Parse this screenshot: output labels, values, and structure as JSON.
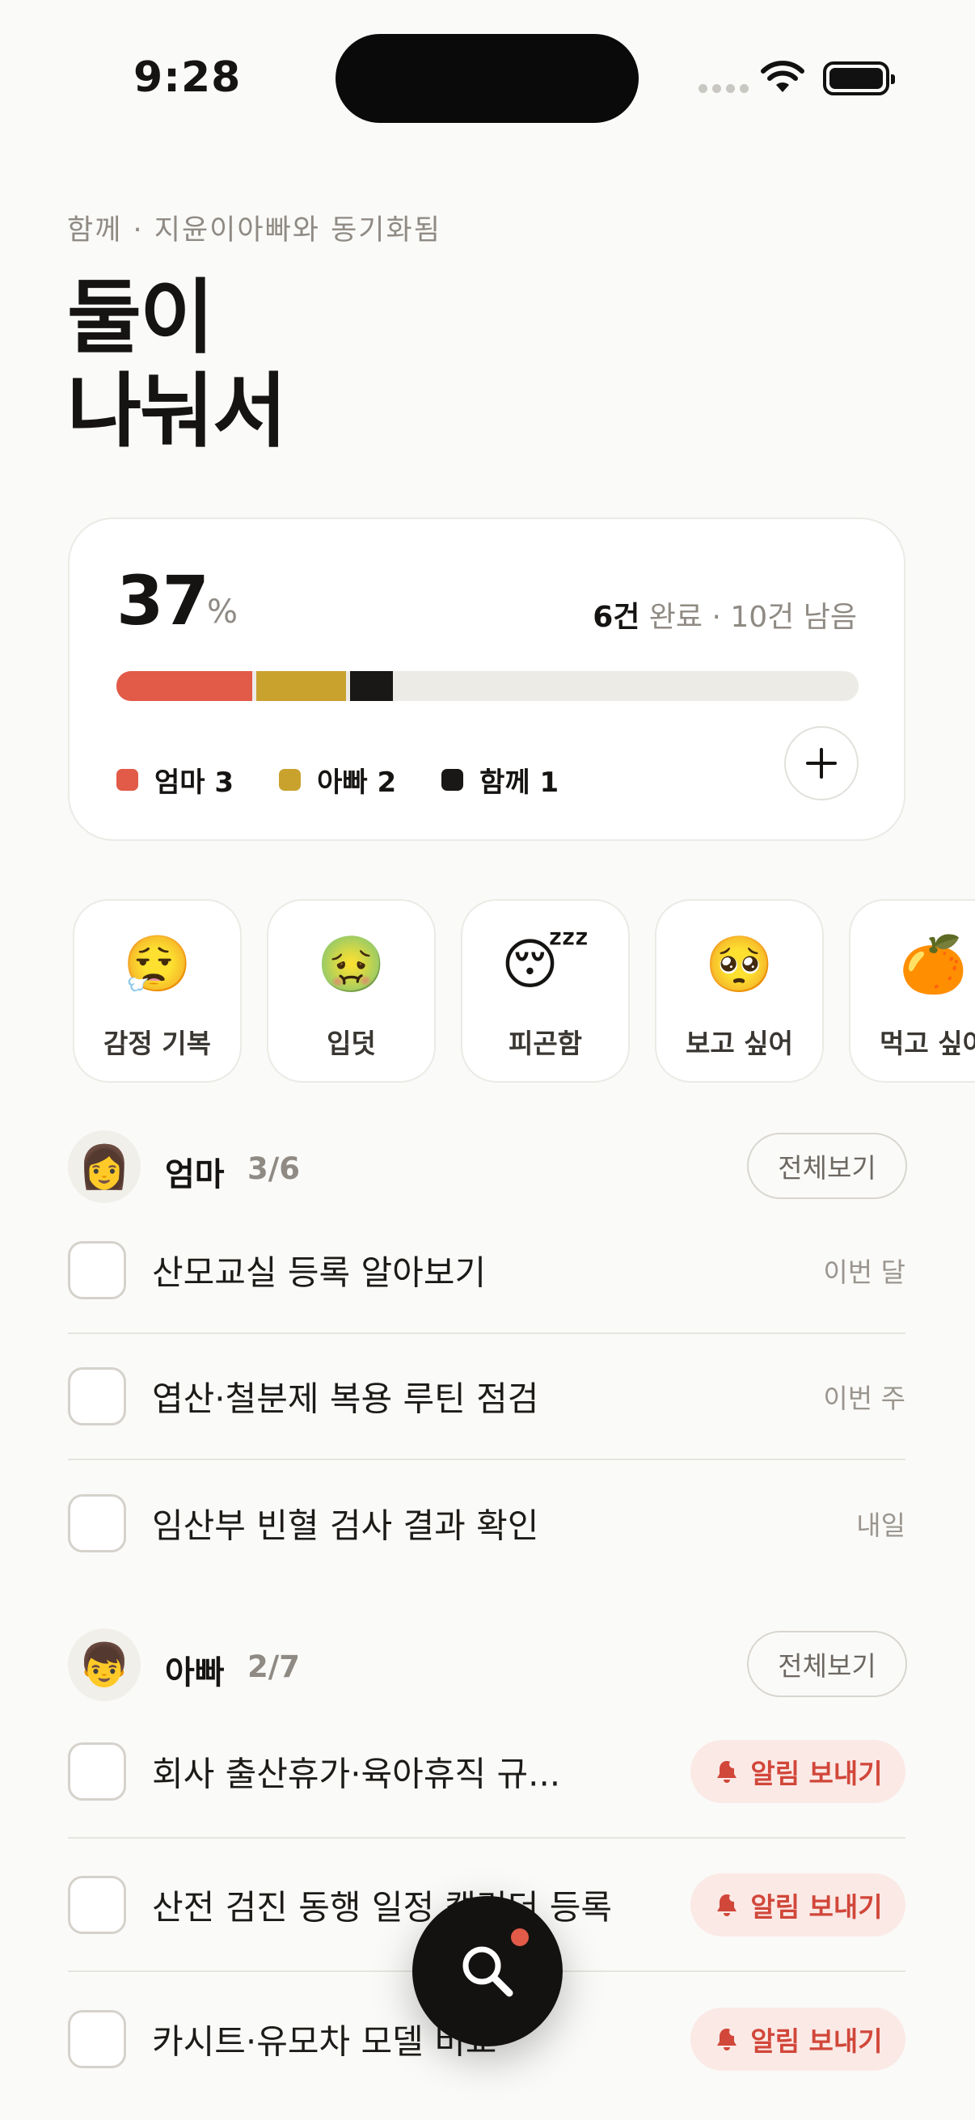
{
  "status": {
    "time": "9:28"
  },
  "header": {
    "subtitle": "함께 · 지윤이아빠와 동기화됨",
    "title_line1": "둘이",
    "title_line2": "나눠서"
  },
  "summary": {
    "percent": "37",
    "percent_unit": "%",
    "done_count": "6건",
    "rest": " 완료 · 10건 남음",
    "progress_segments": [
      {
        "name": "엄마",
        "fraction": 0.1875,
        "color": "#E25A48"
      },
      {
        "name": "아빠",
        "fraction": 0.125,
        "color": "#C9A22E"
      },
      {
        "name": "함께",
        "fraction": 0.0625,
        "color": "#1A1816"
      }
    ],
    "legend": [
      {
        "label": "엄마 3",
        "color": "#E25A48"
      },
      {
        "label": "아빠 2",
        "color": "#C9A22E"
      },
      {
        "label": "함께 1",
        "color": "#1A1816"
      }
    ],
    "add_icon": "plus-icon"
  },
  "moods": [
    {
      "emoji": "😮‍💨",
      "label": "감정 기복"
    },
    {
      "emoji": "🤢",
      "label": "입덧"
    },
    {
      "emoji": "😴",
      "label": "피곤함"
    },
    {
      "emoji": "🥺",
      "label": "보고 싶어"
    },
    {
      "emoji": "🍊",
      "label": "먹고 싶어"
    }
  ],
  "mom": {
    "avatar": "👩",
    "name": "엄마",
    "count": "3/6",
    "see_all": "전체보기",
    "tasks": [
      {
        "title": "산모교실 등록 알아보기",
        "due": "이번 달"
      },
      {
        "title": "엽산·철분제 복용 루틴 점검",
        "due": "이번 주"
      },
      {
        "title": "임산부 빈혈 검사 결과 확인",
        "due": "내일"
      }
    ]
  },
  "dad": {
    "avatar": "👦",
    "name": "아빠",
    "count": "2/7",
    "see_all": "전체보기",
    "notify_label": "알림 보내기",
    "tasks": [
      {
        "title": "회사 출산휴가·육아휴직 규..."
      },
      {
        "title": "산전 검진 동행 일정 캘린더 등록"
      },
      {
        "title": "카시트·유모차 모델 비교"
      }
    ]
  },
  "fab": {
    "icon": "search-icon",
    "accent": "#E25A48"
  }
}
